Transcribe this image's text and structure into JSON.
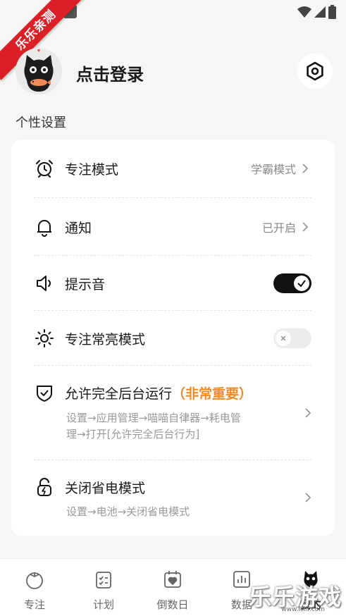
{
  "ribbon": "乐乐亲测",
  "profile": {
    "login_label": "点击登录"
  },
  "section_personal": "个性设置",
  "settings": {
    "focus_mode": {
      "label": "专注模式",
      "value": "学霸模式"
    },
    "notification": {
      "label": "通知",
      "value": "已开启"
    },
    "sound": {
      "label": "提示音",
      "toggle": true
    },
    "always_on": {
      "label": "专注常亮模式",
      "toggle": false
    },
    "background": {
      "label": "允许完全后台运行",
      "important": "（非常重要）",
      "hint_line1": "设置→应用管理→喵喵自律器→耗电管",
      "hint_line2": "理→打开[允许完全后台行为]"
    },
    "power_saving": {
      "label": "关闭省电模式",
      "hint": "设置→电池→关闭省电模式"
    }
  },
  "tabs": [
    {
      "label": "专注"
    },
    {
      "label": "计划"
    },
    {
      "label": "倒数日"
    },
    {
      "label": "数据"
    },
    {
      "label": "我的"
    }
  ],
  "watermark": {
    "text": "乐乐游戏",
    "url": "www.lolll.com"
  },
  "colors": {
    "important": "#f08a25",
    "ribbon": "#d92027",
    "toggle_on": "#111111"
  }
}
